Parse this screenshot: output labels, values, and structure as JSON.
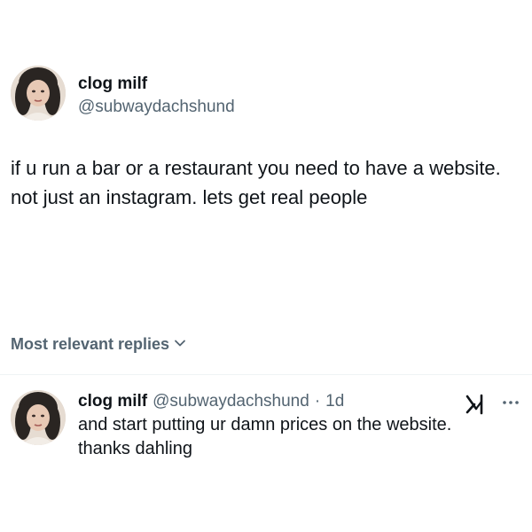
{
  "tweet": {
    "author": {
      "display_name": "clog milf",
      "handle": "@subwaydachshund"
    },
    "text": "if u run a bar or a restaurant you need to have a website. not just an instagram. lets get real people"
  },
  "replies_section": {
    "sort_label": "Most relevant replies"
  },
  "reply": {
    "author": {
      "display_name": "clog milf",
      "handle": "@subwaydachshund"
    },
    "separator": "·",
    "time": "1d",
    "text": "and start putting ur damn prices on the website. thanks dahling"
  },
  "icons": {
    "avatar": "avatar-photo",
    "chevron": "chevron-down-icon",
    "grok": "grok-icon",
    "more": "more-options-icon"
  }
}
